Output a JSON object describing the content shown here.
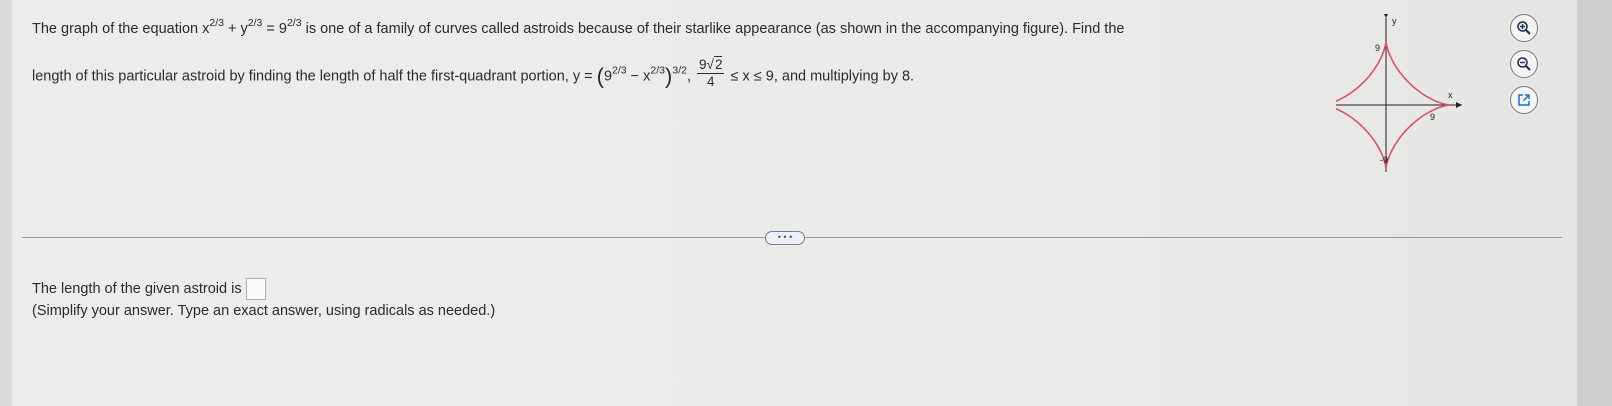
{
  "problem": {
    "line1": {
      "intro": "The graph of the equation x",
      "exp1": "2/3",
      "plus": " + y",
      "exp2": "2/3",
      "eq": " = 9",
      "exp3": "2/3",
      "rest": " is one of a family of curves called astroids because of their starlike appearance (as shown in the accompanying figure). Find the"
    },
    "line2": {
      "intro": "length of this particular astroid by finding the length of half the first-quadrant portion, y = ",
      "base1": "9",
      "exp1": "2/3",
      "minus": " − x",
      "exp2": "2/3",
      "outer_exp": "3/2",
      "comma": ",",
      "frac_coef": "9",
      "frac_rad": "2",
      "frac_den": "4",
      "ineq": " ≤ x ≤ 9, and multiplying by 8."
    }
  },
  "figure": {
    "y_axis_label": "y",
    "x_axis_label": "x",
    "tick_top": "9",
    "tick_bottom": "-9",
    "tick_left": "-9",
    "tick_right": "9",
    "curve_color": "#d9536b",
    "axis_color": "#222222"
  },
  "tools": {
    "zoom_in_icon": "zoom-in-icon",
    "zoom_out_icon": "zoom-out-icon",
    "popout_icon": "external-link-icon"
  },
  "divider": {
    "handle_label": "• • •"
  },
  "answer": {
    "prompt": "The length of the given astroid is",
    "instruction": "(Simplify your answer. Type an exact answer, using radicals as needed.)"
  }
}
